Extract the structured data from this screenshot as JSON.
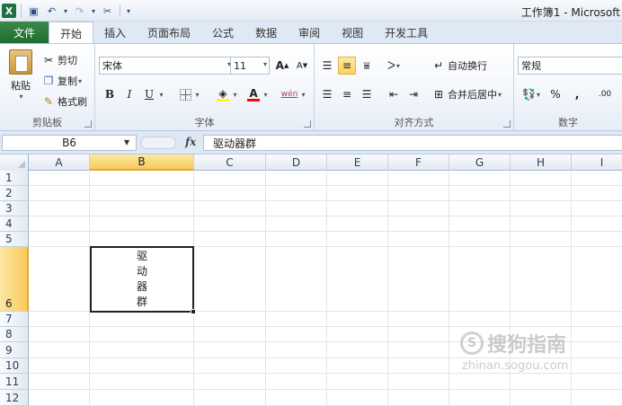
{
  "window": {
    "title": "工作簿1 - Microsoft"
  },
  "tabs": {
    "file": "文件",
    "items": [
      "开始",
      "插入",
      "页面布局",
      "公式",
      "数据",
      "审阅",
      "视图",
      "开发工具"
    ],
    "active": "开始"
  },
  "clipboard": {
    "paste": "粘贴",
    "cut": "剪切",
    "copy": "复制",
    "format_painter": "格式刷",
    "label": "剪贴板"
  },
  "font": {
    "name": "宋体",
    "size": "11",
    "bold": "B",
    "italic": "I",
    "underline": "U",
    "grow": "A",
    "shrink": "A",
    "font_color": "A",
    "phonetic": "wén",
    "label": "字体"
  },
  "alignment": {
    "wrap_text": "自动换行",
    "merge_center": "合并后居中",
    "label": "对齐方式"
  },
  "number": {
    "format": "常规",
    "percent": "%",
    "comma": ",",
    "increase_decimal": ".00",
    "label": "数字"
  },
  "formula_bar": {
    "name_box": "B6",
    "fx": "fx",
    "content": "驱动器群"
  },
  "grid": {
    "columns": [
      "A",
      "B",
      "C",
      "D",
      "E",
      "F",
      "G",
      "H",
      "I"
    ],
    "rows": [
      "1",
      "2",
      "3",
      "4",
      "5",
      "6",
      "7",
      "8",
      "9",
      "10",
      "11",
      "12"
    ],
    "selected_column": "B",
    "selected_row": "6",
    "cell_b6_lines": [
      "驱",
      "动",
      "器",
      "群"
    ]
  },
  "watermark": {
    "main": "搜狗指南",
    "sub": "zhinan.sogou.com"
  }
}
